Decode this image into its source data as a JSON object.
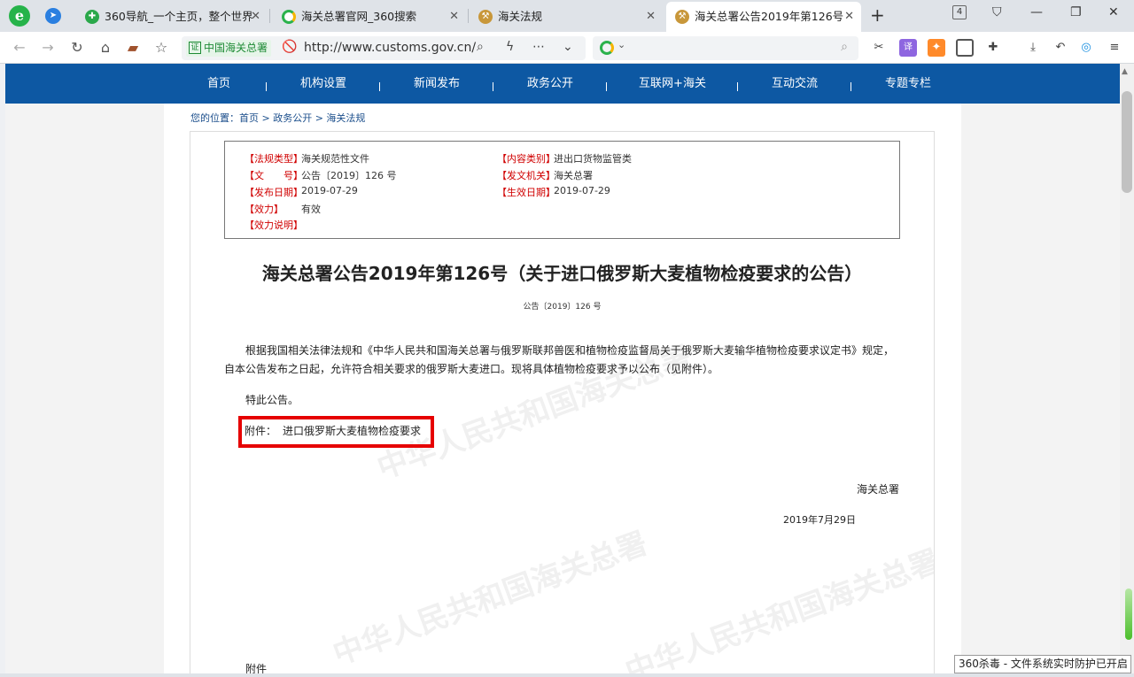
{
  "browser": {
    "tabs": [
      {
        "title": "360导航_一个主页，整个世界",
        "icon": "360-nav-icon",
        "active": false
      },
      {
        "title": "海关总署官网_360搜索",
        "icon": "360-search-icon",
        "active": false
      },
      {
        "title": "海关法规",
        "icon": "customs-emblem-icon",
        "active": false
      },
      {
        "title": "海关总署公告2019年第126号",
        "icon": "customs-emblem-icon",
        "active": true
      }
    ],
    "tab_close": "✕",
    "new_tab": "+",
    "tab_count": "4",
    "cert_label": "中国海关总署",
    "cert_icon_text": "证",
    "url": "http://www.customs.gov.cn/",
    "search_suffix": "⌄",
    "toast": "360杀毒 - 文件系统实时防护已开启"
  },
  "site_nav": {
    "items": [
      "首页",
      "机构设置",
      "新闻发布",
      "政务公开",
      "互联网+海关",
      "互动交流",
      "专题专栏"
    ],
    "separator": "|"
  },
  "breadcrumb": "您的位置：首页 > 政务公开 > 海关法规",
  "meta": {
    "left": [
      {
        "key": "【法规类型】",
        "value": "海关规范性文件"
      },
      {
        "key": "【文　　号】",
        "value": "公告〔2019〕126 号"
      },
      {
        "key": "【发布日期】",
        "value": "2019-07-29"
      },
      {
        "key": "【效力】",
        "value": "有效"
      },
      {
        "key": "【效力说明】",
        "value": ""
      }
    ],
    "right": [
      {
        "key": "【内容类别】",
        "value": "进出口货物监管类"
      },
      {
        "key": "【发文机关】",
        "value": "海关总署"
      },
      {
        "key": "【生效日期】",
        "value": "2019-07-29"
      }
    ]
  },
  "document": {
    "title": "海关总署公告2019年第126号（关于进口俄罗斯大麦植物检疫要求的公告）",
    "doc_number": "公告〔2019〕126 号",
    "paragraph": "根据我国相关法律法规和《中华人民共和国海关总署与俄罗斯联邦兽医和植物检疫监督局关于俄罗斯大麦输华植物检疫要求议定书》规定，自本公告发布之日起，允许符合相关要求的俄罗斯大麦进口。现将具体植物检疫要求予以公布（见附件）。",
    "notice": "特此公告。",
    "attachment_label": "附件：",
    "attachment_link": "进口俄罗斯大麦植物检疫要求",
    "signature": "海关总署",
    "date": "2019年7月29日",
    "attachment_footer": "附件",
    "watermark": "中华人民共和国海关总署"
  },
  "colors": {
    "nav_blue": "#0d58a3",
    "meta_key_red": "#d00000",
    "highlight_red": "#e60000"
  }
}
